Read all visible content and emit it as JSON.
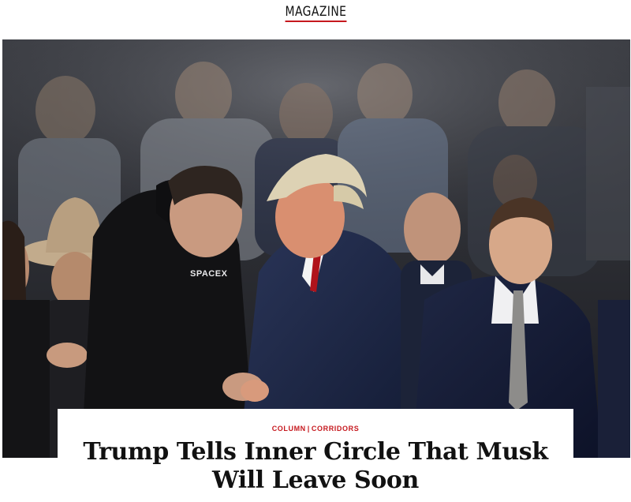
{
  "header": {
    "section_label": "MAGAZINE"
  },
  "hero": {
    "image_alt": "Photo of Elon Musk in a black SpaceX hoodie shaking hands with Donald Trump in a navy overcoat and red tie, in front of a crowd",
    "hoodie_text": "SPACEX"
  },
  "article": {
    "category": "COLUMN",
    "subcategory": "CORRIDORS",
    "separator": "|",
    "headline_line1": "Trump Tells Inner Circle That Musk",
    "headline_line2": "Will Leave Soon"
  },
  "colors": {
    "accent": "#c6181e",
    "text": "#111111",
    "background": "#ffffff"
  }
}
